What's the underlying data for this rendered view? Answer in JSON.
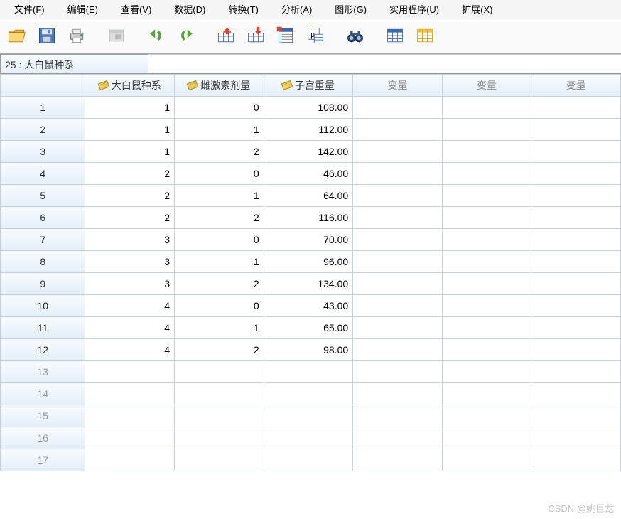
{
  "menu": {
    "file": "文件(F)",
    "edit": "编辑(E)",
    "view": "查看(V)",
    "data": "数据(D)",
    "transform": "转换(T)",
    "analyze": "分析(A)",
    "graphs": "图形(G)",
    "utilities": "实用程序(U)",
    "extensions": "扩展(X)"
  },
  "namebox": {
    "label": "25 : 大白鼠种系"
  },
  "columns": {
    "c1": "大白鼠种系",
    "c2": "雌激素剂量",
    "c3": "子宫重量",
    "placeholder": "变量"
  },
  "rows": [
    {
      "n": "1",
      "a": "1",
      "b": "0",
      "c": "108.00"
    },
    {
      "n": "2",
      "a": "1",
      "b": "1",
      "c": "112.00"
    },
    {
      "n": "3",
      "a": "1",
      "b": "2",
      "c": "142.00"
    },
    {
      "n": "4",
      "a": "2",
      "b": "0",
      "c": "46.00"
    },
    {
      "n": "5",
      "a": "2",
      "b": "1",
      "c": "64.00"
    },
    {
      "n": "6",
      "a": "2",
      "b": "2",
      "c": "116.00"
    },
    {
      "n": "7",
      "a": "3",
      "b": "0",
      "c": "70.00"
    },
    {
      "n": "8",
      "a": "3",
      "b": "1",
      "c": "96.00"
    },
    {
      "n": "9",
      "a": "3",
      "b": "2",
      "c": "134.00"
    },
    {
      "n": "10",
      "a": "4",
      "b": "0",
      "c": "43.00"
    },
    {
      "n": "11",
      "a": "4",
      "b": "1",
      "c": "65.00"
    },
    {
      "n": "12",
      "a": "4",
      "b": "2",
      "c": "98.00"
    }
  ],
  "empty_rows": [
    "13",
    "14",
    "15",
    "16",
    "17"
  ],
  "watermark": "CSDN @姚巨龙"
}
